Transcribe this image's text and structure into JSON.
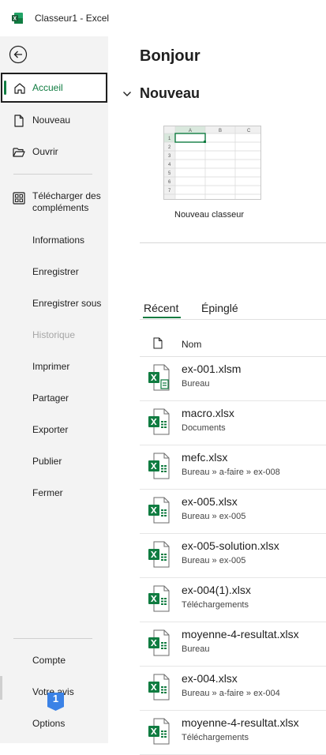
{
  "window": {
    "title": "Classeur1  -  Excel"
  },
  "sidebar": {
    "items": [
      {
        "label": "Accueil",
        "icon": "home-icon"
      },
      {
        "label": "Nouveau",
        "icon": "new-document-icon"
      },
      {
        "label": "Ouvrir",
        "icon": "open-folder-icon"
      },
      {
        "label": "Télécharger des compléments",
        "line1": "Télécharger des",
        "line2": "compléments",
        "icon": "add-ins-icon"
      },
      {
        "label": "Informations"
      },
      {
        "label": "Enregistrer"
      },
      {
        "label": "Enregistrer sous"
      },
      {
        "label": "Historique"
      },
      {
        "label": "Imprimer"
      },
      {
        "label": "Partager"
      },
      {
        "label": "Exporter"
      },
      {
        "label": "Publier"
      },
      {
        "label": "Fermer"
      },
      {
        "label": "Compte"
      },
      {
        "label": "Votre avis"
      },
      {
        "label": "Options"
      }
    ]
  },
  "main": {
    "greeting": "Bonjour",
    "new_section": "Nouveau",
    "template": {
      "label": "Nouveau classeur",
      "cols": [
        "A",
        "B",
        "C"
      ],
      "rows": [
        "1",
        "2",
        "3",
        "4",
        "5",
        "6",
        "7"
      ]
    },
    "tabs": [
      {
        "label": "Récent"
      },
      {
        "label": "Épinglé"
      }
    ],
    "column_header": "Nom",
    "files": [
      {
        "name": "ex-001.xlsm",
        "path": "Bureau",
        "macro": true
      },
      {
        "name": "macro.xlsx",
        "path": "Documents"
      },
      {
        "name": "mefc.xlsx",
        "path": "Bureau » a-faire » ex-008"
      },
      {
        "name": "ex-005.xlsx",
        "path": "Bureau » ex-005"
      },
      {
        "name": "ex-005-solution.xlsx",
        "path": "Bureau » ex-005"
      },
      {
        "name": "ex-004(1).xlsx",
        "path": "Téléchargements"
      },
      {
        "name": "moyenne-4-resultat.xlsx",
        "path": "Bureau"
      },
      {
        "name": "ex-004.xlsx",
        "path": "Bureau » a-faire » ex-004"
      },
      {
        "name": "moyenne-4-resultat.xlsx",
        "path": "Téléchargements"
      }
    ]
  },
  "badge": {
    "value": "1"
  },
  "colors": {
    "accent": "#107c41",
    "sidebar_bg": "#f3f3f3",
    "badge": "#3b82e6"
  }
}
